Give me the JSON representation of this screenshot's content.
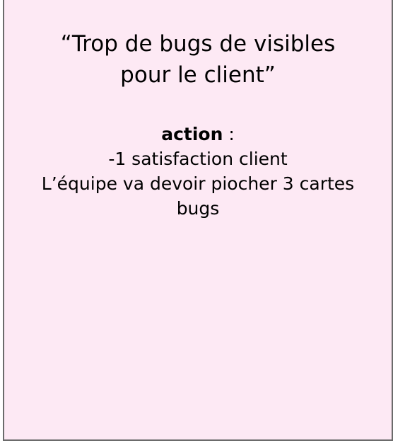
{
  "card": {
    "title_line1": "“Trop de bugs de visibles",
    "title_line2": "pour le client”",
    "action_label": "action",
    "action_colon": " :",
    "effect_line1": "-1 satisfaction client",
    "effect_line2": "L’équipe va devoir piocher 3 cartes",
    "effect_line3": "bugs"
  },
  "colors": {
    "card_background": "#fde9f4",
    "border": "#6b6b6b",
    "text": "#000000"
  }
}
